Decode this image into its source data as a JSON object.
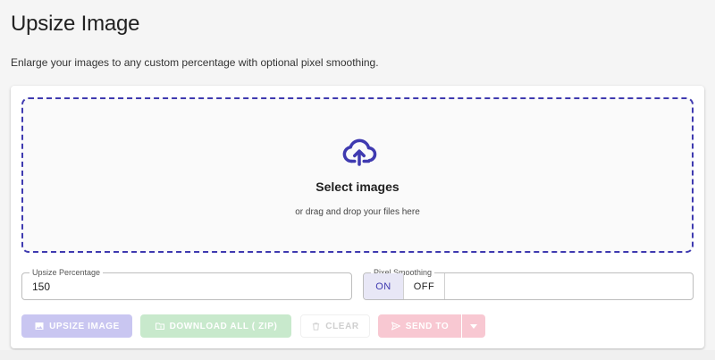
{
  "page": {
    "title": "Upsize Image",
    "subtitle": "Enlarge your images to any custom percentage with optional pixel smoothing."
  },
  "dropzone": {
    "icon": "cloud-upload-icon",
    "title": "Select images",
    "subtitle": "or drag and drop your files here"
  },
  "upsize_percentage": {
    "label": "Upsize Percentage",
    "value": "150"
  },
  "pixel_smoothing": {
    "label": "Pixel Smoothing",
    "options": [
      "ON",
      "OFF"
    ],
    "selected": "ON"
  },
  "actions": {
    "upsize_label": "UPSIZE IMAGE",
    "download_label": "DOWNLOAD ALL ( ZIP)",
    "clear_label": "CLEAR",
    "send_label": "SEND TO"
  },
  "colors": {
    "accent": "#3f3ab0",
    "upsize_button": "#c9c6f1",
    "download_button": "#c8e9cc",
    "send_button": "#f8c8d2",
    "toggle_selected_bg": "#e8e7f6"
  }
}
